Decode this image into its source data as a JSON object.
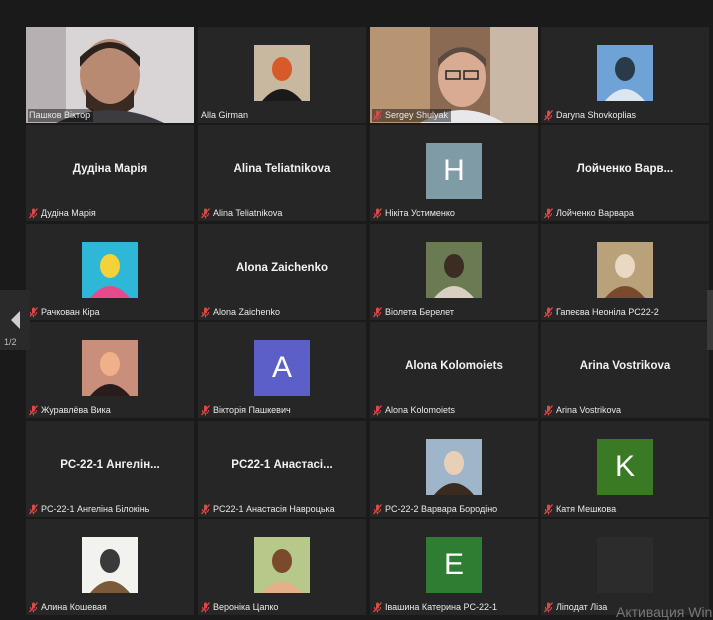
{
  "pager": {
    "label": "1/2"
  },
  "watermark": "Активация Win",
  "tiles": [
    {
      "name": "Пашков Віктор",
      "muted": false,
      "type": "video",
      "active": true
    },
    {
      "name": "Alla Girman",
      "muted": false,
      "type": "photo"
    },
    {
      "name": "Sergey Shulyak",
      "muted": true,
      "type": "video"
    },
    {
      "name": "Daryna Shovkoplias",
      "muted": true,
      "type": "photo"
    },
    {
      "name": "Дудіна Марія",
      "muted": true,
      "type": "name",
      "display": "Дудіна Марія"
    },
    {
      "name": "Alina Teliatnikova",
      "muted": true,
      "type": "name",
      "display": "Alina Teliatnikova"
    },
    {
      "name": "Нікіта Устименко",
      "muted": true,
      "type": "letter",
      "letter": "H",
      "color": "#7f9ba5"
    },
    {
      "name": "Лойченко Варвара",
      "muted": true,
      "type": "name",
      "display": "Лойченко  Варв..."
    },
    {
      "name": "Рачкован Кіра",
      "muted": true,
      "type": "photo"
    },
    {
      "name": "Alona Zaichenko",
      "muted": true,
      "type": "name",
      "display": "Alona Zaichenko"
    },
    {
      "name": "Віолета Берелет",
      "muted": true,
      "type": "photo"
    },
    {
      "name": "Гапеєва Неоніла PC22-2",
      "muted": true,
      "type": "photo"
    },
    {
      "name": "Журавлёва Вика",
      "muted": true,
      "type": "photo"
    },
    {
      "name": "Вікторія Пашкевич",
      "muted": true,
      "type": "letter",
      "letter": "A",
      "color": "#5b5fc7"
    },
    {
      "name": "Alona Kolomoiets",
      "muted": true,
      "type": "name",
      "display": "Alona Kolomoiets"
    },
    {
      "name": "Arina Vostrikova",
      "muted": true,
      "type": "name",
      "display": "Arina Vostrikova"
    },
    {
      "name": "PC-22-1 Ангеліна Білокінь",
      "muted": true,
      "type": "name",
      "display": "PC-22-1  Ангелін..."
    },
    {
      "name": "PC22-1 Анастасія Навроцька",
      "muted": true,
      "type": "name",
      "display": "PC22-1  Анастасі..."
    },
    {
      "name": "PC-22-2 Варвара Бородіно",
      "muted": true,
      "type": "photo"
    },
    {
      "name": "Катя Мешкова",
      "muted": true,
      "type": "letter",
      "letter": "K",
      "color": "#3a7a24"
    },
    {
      "name": "Алина Кошевая",
      "muted": true,
      "type": "photo"
    },
    {
      "name": "Вероніка Цапко",
      "muted": true,
      "type": "photo"
    },
    {
      "name": "Івашина Катерина PC-22-1",
      "muted": true,
      "type": "letter",
      "letter": "E",
      "color": "#2e7d32"
    },
    {
      "name": "Ліподат Ліза",
      "muted": true,
      "type": "blank"
    }
  ]
}
